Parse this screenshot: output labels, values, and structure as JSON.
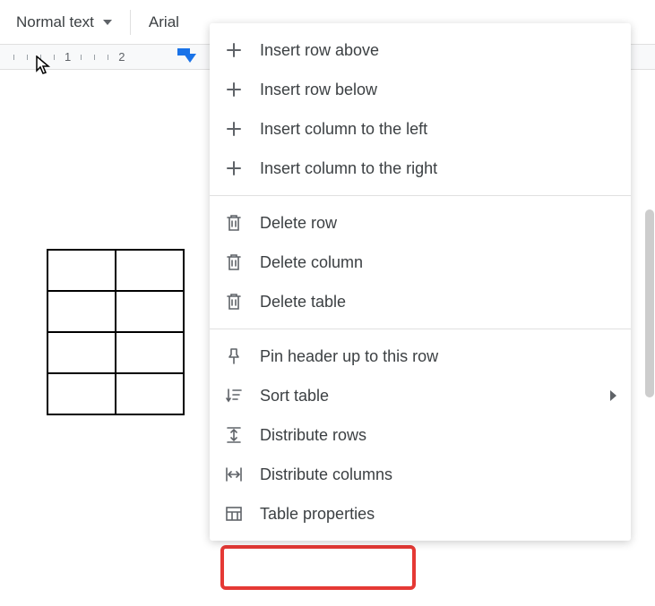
{
  "toolbar": {
    "style_label": "Normal text",
    "font_label": "Arial"
  },
  "ruler": {
    "marks": [
      "1",
      "2"
    ]
  },
  "menu": {
    "insert_row_above": "Insert row above",
    "insert_row_below": "Insert row below",
    "insert_col_left": "Insert column to the left",
    "insert_col_right": "Insert column to the right",
    "delete_row": "Delete row",
    "delete_column": "Delete column",
    "delete_table": "Delete table",
    "pin_header": "Pin header up to this row",
    "sort_table": "Sort table",
    "distribute_rows": "Distribute rows",
    "distribute_columns": "Distribute columns",
    "table_properties": "Table properties"
  }
}
